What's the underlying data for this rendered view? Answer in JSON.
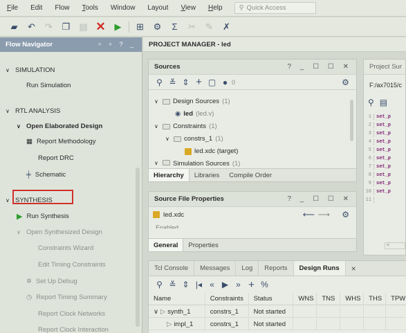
{
  "menubar": {
    "items": [
      "File",
      "Edit",
      "Flow",
      "Tools",
      "Window",
      "Layout",
      "View",
      "Help"
    ],
    "quick_access_placeholder": "Quick Access"
  },
  "flow_navigator": {
    "title": "Flow Navigator",
    "controls": "÷ ÷ ? _",
    "simulation": {
      "label": "SIMULATION",
      "run": "Run Simulation"
    },
    "rtl": {
      "label": "RTL ANALYSIS",
      "open_elab": "Open Elaborated Design",
      "report_methodology": "Report Methodology",
      "report_drc": "Report DRC",
      "schematic": "Schematic"
    },
    "synthesis": {
      "label": "SYNTHESIS",
      "run": "Run Synthesis",
      "open_synth": "Open Synthesized Design",
      "constraints_wizard": "Constraints Wizard",
      "edit_timing": "Edit Timing Constraints",
      "setup_debug": "Set Up Debug",
      "report_timing": "Report Timing Summary",
      "report_clock_networks": "Report Clock Networks",
      "report_clock_interaction": "Report Clock Interaction"
    }
  },
  "project_manager": {
    "title": "PROJECT MANAGER - led"
  },
  "sources": {
    "title": "Sources",
    "controls": "? _ ☐ ☐ ✕",
    "counter": "0",
    "design_sources": "Design Sources",
    "design_sources_count": "(1)",
    "led_name": "led",
    "led_file": "(led.v)",
    "constraints": "Constraints",
    "constraints_count": "(1)",
    "constrs_1": "constrs_1",
    "constrs_1_count": "(1)",
    "xdc": "led.xdc (target)",
    "sim_sources": "Simulation Sources",
    "sim_sources_count": "(1)",
    "tabs": [
      "Hierarchy",
      "Libraries",
      "Compile Order"
    ]
  },
  "file_props": {
    "title": "Source File Properties",
    "controls": "? _ ☐ ☐ ✕",
    "filename": "led.xdc",
    "enabled": "Enabled",
    "tabs": [
      "General",
      "Properties"
    ]
  },
  "project_summary": {
    "title": "Project Sur",
    "path": "F:/ax7015/c",
    "lines": [
      "1",
      "2",
      "3",
      "4",
      "5",
      "6",
      "7",
      "8",
      "9",
      "10",
      "11"
    ],
    "code": [
      "set_p",
      "set_p",
      "set_p",
      "set_p",
      "set_p",
      "set_p",
      "set_p",
      "set_p",
      "set_p",
      "set_p",
      ""
    ]
  },
  "bottom": {
    "tabs": [
      "Tcl Console",
      "Messages",
      "Log",
      "Reports",
      "Design Runs"
    ],
    "close": "×",
    "columns": [
      "Name",
      "Constraints",
      "Status",
      "WNS",
      "TNS",
      "WHS",
      "THS",
      "TPW"
    ],
    "rows": [
      {
        "name": "synth_1",
        "constraints": "constrs_1",
        "status": "Not started"
      },
      {
        "name": "impl_1",
        "constraints": "constrs_1",
        "status": "Not started"
      }
    ]
  },
  "colors": {
    "accent_red": "#d0302b",
    "header_blue": "#8b9cae",
    "run_green": "#2c9d2e"
  }
}
